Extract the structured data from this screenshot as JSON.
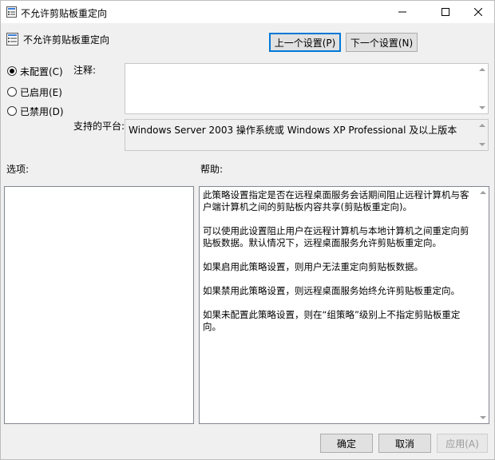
{
  "window": {
    "title": "不允许剪贴板重定向",
    "controls": {
      "minimize_icon": "minimize-icon",
      "maximize_icon": "maximize-icon",
      "close_icon": "close-icon"
    }
  },
  "header": {
    "policy_name": "不允许剪贴板重定向",
    "prev_button": "上一个设置(P)",
    "next_button": "下一个设置(N)"
  },
  "state": {
    "options": [
      {
        "label": "未配置(C)",
        "checked": true
      },
      {
        "label": "已启用(E)",
        "checked": false
      },
      {
        "label": "已禁用(D)",
        "checked": false
      }
    ]
  },
  "comment": {
    "label": "注释:",
    "value": ""
  },
  "platform": {
    "label": "支持的平台:",
    "value": "Windows Server 2003 操作系统或 Windows XP Professional 及以上版本"
  },
  "options_panel": {
    "label": "选项:"
  },
  "help_panel": {
    "label": "帮助:",
    "paragraphs": [
      "此策略设置指定是否在远程桌面服务会话期间阻止远程计算机与客户端计算机之间的剪贴板内容共享(剪贴板重定向)。",
      "可以使用此设置阻止用户在远程计算机与本地计算机之间重定向剪贴板数据。默认情况下，远程桌面服务允许剪贴板重定向。",
      "如果启用此策略设置，则用户无法重定向剪贴板数据。",
      "如果禁用此策略设置，则远程桌面服务始终允许剪贴板重定向。",
      "如果未配置此策略设置，则在“组策略”级别上不指定剪贴板重定向。"
    ]
  },
  "footer": {
    "ok": "确定",
    "cancel": "取消",
    "apply": "应用(A)"
  }
}
